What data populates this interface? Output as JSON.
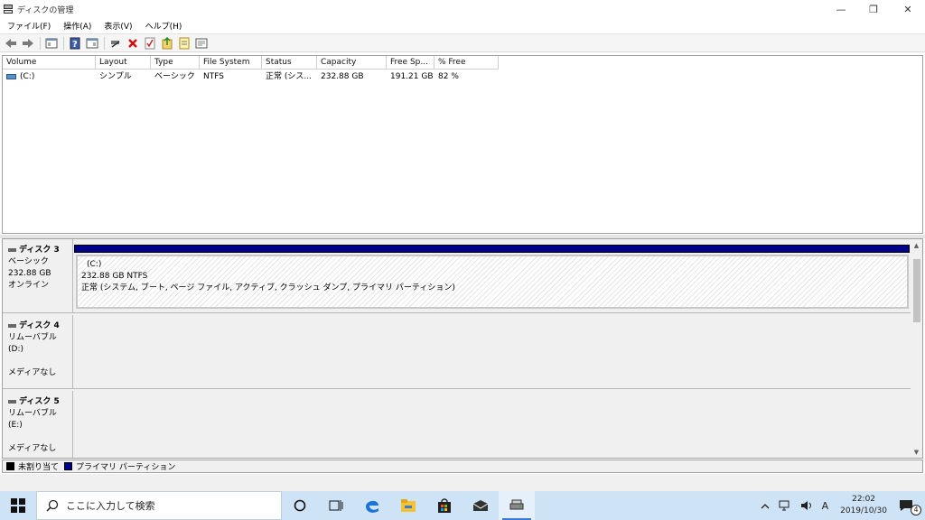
{
  "window": {
    "title": "ディスクの管理",
    "minimize_glyph": "—",
    "restore_glyph": "❐",
    "close_glyph": "✕"
  },
  "menu": [
    "ファイル(F)",
    "操作(A)",
    "表示(V)",
    "ヘルプ(H)"
  ],
  "toolbar": {
    "icons": [
      "back-arrow-icon",
      "forward-arrow-icon",
      "console-tree-icon",
      "help-icon",
      "properties-icon",
      "connect-icon",
      "delete-icon",
      "checklist-icon",
      "export-icon",
      "rescan-icon",
      "settings-icon"
    ]
  },
  "volume_list": {
    "columns": [
      "Volume",
      "Layout",
      "Type",
      "File System",
      "Status",
      "Capacity",
      "Free Sp...",
      "% Free"
    ],
    "rows": [
      {
        "volume": "(C:)",
        "layout": "シンプル",
        "type": "ベーシック",
        "fs": "NTFS",
        "status": "正常 (シス...",
        "capacity": "232.88 GB",
        "free": "191.21 GB",
        "pct": "82 %"
      }
    ]
  },
  "disks": [
    {
      "name": "ディスク 3",
      "type": "ベーシック",
      "size": "232.88 GB",
      "state": "オンライン",
      "partition": {
        "label": "(C:)",
        "size_fs": "232.88 GB NTFS",
        "status": "正常 (システム, ブート, ページ ファイル, アクティブ, クラッシュ ダンプ, プライマリ パーティション)"
      }
    },
    {
      "name": "ディスク 4",
      "type": "リムーバブル (D:)",
      "media": "メディアなし"
    },
    {
      "name": "ディスク 5",
      "type": "リムーバブル (E:)",
      "media": "メディアなし"
    }
  ],
  "legend": {
    "unallocated": "未割り当て",
    "primary": "プライマリ パーティション",
    "unallocated_color": "#000000",
    "primary_color": "#00008b"
  },
  "taskbar": {
    "search_placeholder": "ここに入力して検索",
    "time": "22:02",
    "date": "2019/10/30",
    "ime": "A",
    "notifications": "4"
  }
}
